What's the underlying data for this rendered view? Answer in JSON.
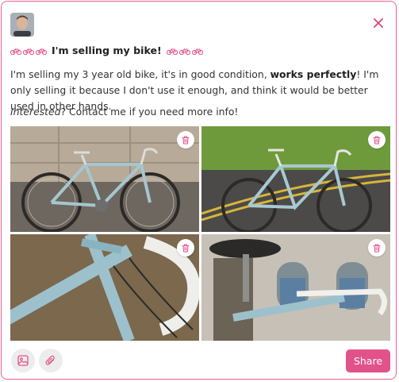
{
  "post": {
    "title": "I'm selling my bike!",
    "title_decoration_icon": "bicycle-icon",
    "p1_a": "I'm selling my 3 year old bike, it's in good condition, ",
    "p1_bold": "works perfectly",
    "p1_b": "! I'm only selling it because I don't use it enough, and think it would be better used in other hands.",
    "p2_italic": "Interested",
    "p2_rest": "? Contact me if you need more info!"
  },
  "photos": [
    {
      "icon": "trash-icon"
    },
    {
      "icon": "trash-icon"
    },
    {
      "icon": "trash-icon"
    },
    {
      "icon": "trash-icon"
    }
  ],
  "toolbar": {
    "image_icon": "image-icon",
    "attach_icon": "paperclip-icon",
    "share_label": "Share"
  },
  "colors": {
    "accent": "#e2528a",
    "border": "#e75e94"
  }
}
